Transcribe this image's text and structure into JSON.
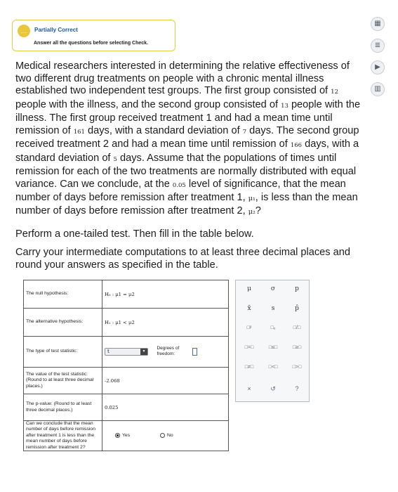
{
  "banner": {
    "title": "Partially Correct",
    "message": "Answer all the questions before selecting Check.",
    "icon": "speech-bubble-icon"
  },
  "side_tools": [
    {
      "icon": "calculator-icon",
      "glyph": "▦"
    },
    {
      "icon": "notepad-icon",
      "glyph": "≣"
    },
    {
      "icon": "video-icon",
      "glyph": "▶"
    },
    {
      "icon": "ebook-icon",
      "glyph": "▥"
    }
  ],
  "problem": {
    "p1": "Medical researchers interested in determining the relative effectiveness of two different drug treatments on people with a chronic mental illness established two independent test groups. The first group consisted of ",
    "n1": "12",
    "p2": " people with the illness, and the second group consisted of ",
    "n2": "13",
    "p3": " people with the illness. The first group received treatment 1 and had a mean time until remission of ",
    "m1": "161",
    "p4": " days, with a standard deviation of ",
    "s1": "7",
    "p5": " days. The second group received treatment 2 and had a mean time until remission of ",
    "m2": "166",
    "p6": " days, with a standard deviation of ",
    "s2": "5",
    "p7": " days. Assume that the populations of times until remission for each of the two treatments are normally distributed with equal variance. Can we conclude, at the ",
    "alpha": "0.05",
    "p8": " level of significance, that the mean number of days before remission after treatment 1, ",
    "mu1": "μ₁",
    "p9": ", is less than the mean number of days before remission after treatment 2, ",
    "mu2": "μ₂",
    "p10": "?"
  },
  "instructions": {
    "line1": "Perform a one-tailed test. Then fill in the table below.",
    "line2": "Carry your intermediate computations to at least three decimal places and round your answers as specified in the table."
  },
  "table": {
    "null_label": "The null hypothesis:",
    "null_value": "H₀ : μ1 = μ2",
    "alt_label": "The alternative hypothesis:",
    "alt_value": "H₁ : μ1 < μ2",
    "stat_type_label": "The type of test statistic:",
    "stat_type_value": "t",
    "df_label": "Degrees of freedom:",
    "test_value_label": "The value of the test statistic: (Round to at least three decimal places.)",
    "test_value": "-2.068",
    "pvalue_label": "The p-value: (Round to at least three decimal places.)",
    "pvalue": "0.025",
    "conclusion_label": "Can we conclude that the mean number of days before remission after treatment 1 is less than the mean number of days before remission after treatment 2?",
    "yes_label": "Yes",
    "no_label": "No",
    "selected": "Yes"
  },
  "palette": {
    "row1": [
      "μ",
      "σ",
      "p"
    ],
    "row2": [
      "x̄",
      "s",
      "p̂"
    ],
    "row3": [
      "□ᵖ",
      "□ₒ",
      "□/□"
    ],
    "row4": [
      "□=□",
      "□≤□",
      "□≥□"
    ],
    "row5": [
      "□≠□",
      "□<□",
      "□>□"
    ],
    "row6": [
      "×",
      "↺",
      "?"
    ]
  }
}
